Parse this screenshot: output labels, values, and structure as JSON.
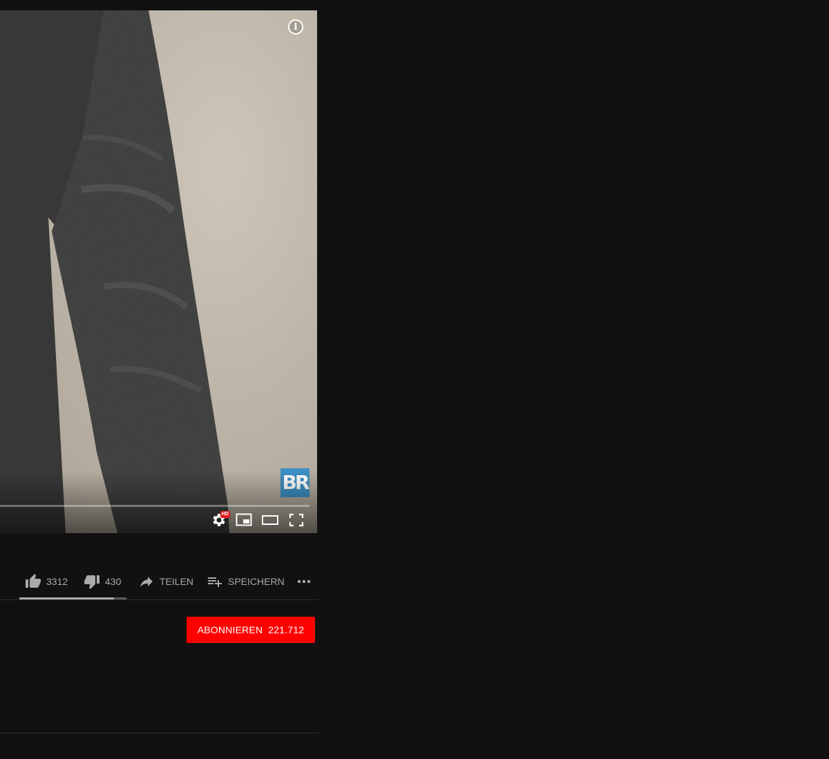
{
  "player": {
    "info_icon": "info-icon",
    "channel_logo": "BR",
    "progress_fraction": 0.0,
    "controls": [
      "settings-icon",
      "miniplayer-icon",
      "theater-mode-icon",
      "fullscreen-icon"
    ],
    "settings_badge": "HD",
    "logo_color": "#3d8fc4"
  },
  "actions": {
    "like_count": "3312",
    "dislike_count": "430",
    "share_label": "TEILEN",
    "save_label": "SPEICHERN",
    "more_icon": "more-horizontal-icon",
    "like_fraction": 0.885
  },
  "subscribe": {
    "label": "ABONNIEREN",
    "count": "221.712",
    "color": "#ff0000"
  }
}
